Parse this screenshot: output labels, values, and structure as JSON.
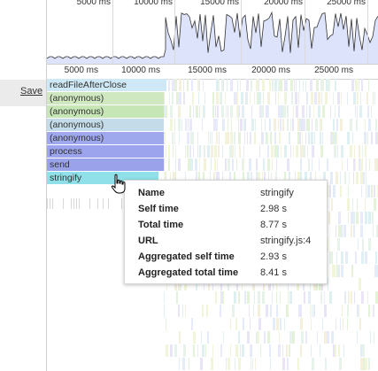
{
  "sidebar": {
    "save_label": "Save"
  },
  "overview": {
    "ticks": [
      "5000 ms",
      "10000 ms",
      "15000 ms",
      "20000 ms",
      "25000 ms"
    ]
  },
  "ruler": {
    "ticks": [
      "5000 ms",
      "10000 ms",
      "15000 ms",
      "20000 ms",
      "25000 ms"
    ]
  },
  "flame": {
    "frames": [
      {
        "label": "readFileAfterClose",
        "color": "#cfe8f5"
      },
      {
        "label": "(anonymous)",
        "color": "#cfe8c0"
      },
      {
        "label": "(anonymous)",
        "color": "#c6e6b6"
      },
      {
        "label": "(anonymous)",
        "color": "#c4dcea"
      },
      {
        "label": "(anonymous)",
        "color": "#9fa8ec"
      },
      {
        "label": "process",
        "color": "#9ba4ec"
      },
      {
        "label": "send",
        "color": "#9aa3ea"
      },
      {
        "label": "stringify",
        "color": "#8fe0e8"
      }
    ]
  },
  "tooltip": {
    "rows": [
      {
        "key": "Name",
        "value": "stringify"
      },
      {
        "key": "Self time",
        "value": "2.98 s"
      },
      {
        "key": "Total time",
        "value": "8.77 s"
      },
      {
        "key": "URL",
        "value": "stringify.js:4"
      },
      {
        "key": "Aggregated self time",
        "value": "2.93 s"
      },
      {
        "key": "Aggregated total time",
        "value": "8.41 s"
      }
    ]
  },
  "colors": {
    "overview_fill": "#dde3fb",
    "overview_line": "#333333",
    "accent": "#9ba4ec"
  },
  "icons": {
    "cursor": "hand-pointer-icon"
  }
}
